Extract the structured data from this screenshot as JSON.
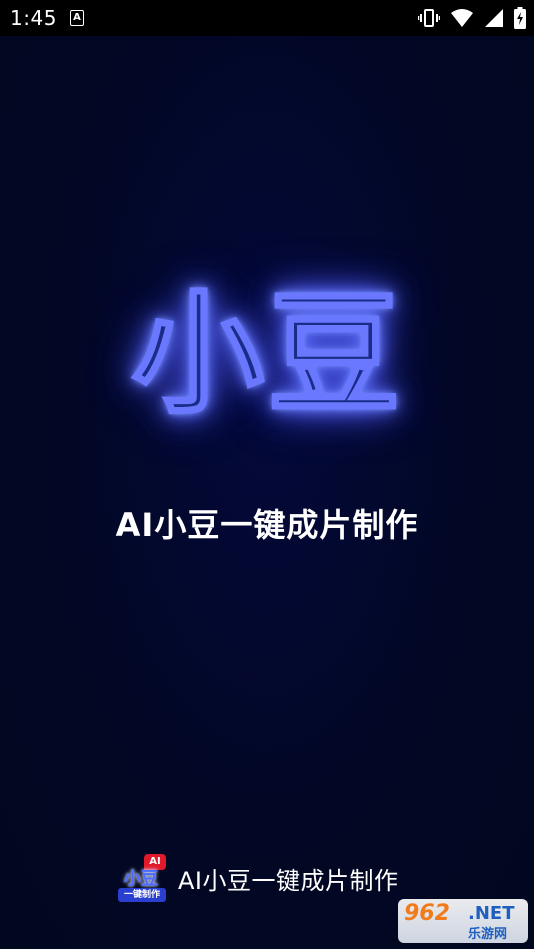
{
  "status_bar": {
    "time": "1:45",
    "a_label": "A",
    "icons": [
      "vibrate-icon",
      "wifi-icon",
      "cell-signal-icon",
      "battery-charging-icon"
    ]
  },
  "splash": {
    "logo_text": "小豆",
    "tagline": "AI小豆一键成片制作"
  },
  "footer": {
    "app_icon": {
      "badge": "AI",
      "title": "小豆",
      "strip": "一键制作"
    },
    "title": "AI小豆一键成片制作"
  },
  "watermark": {
    "number": "962",
    "net": ".NET",
    "cn": "乐游网"
  },
  "colors": {
    "background": "#020720",
    "status_bar": "#000000",
    "logo_fill": "#1b2c88",
    "logo_glow": "#6a78ff",
    "badge_red": "#e01a2b"
  }
}
